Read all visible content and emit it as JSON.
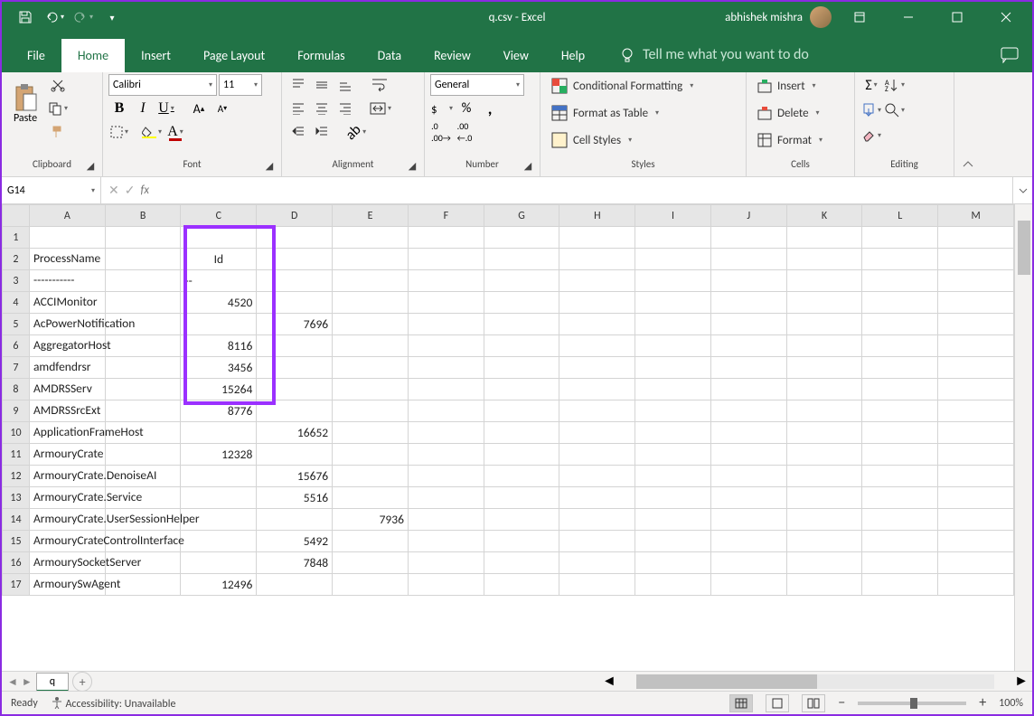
{
  "title": "q.csv - Excel",
  "user": "abhishek mishra",
  "tabs": [
    "File",
    "Home",
    "Insert",
    "Page Layout",
    "Formulas",
    "Data",
    "Review",
    "View",
    "Help"
  ],
  "tell": "Tell me what you want to do",
  "font": {
    "name": "Calibri",
    "size": "11"
  },
  "num_format": "General",
  "groups": {
    "clipboard": "Clipboard",
    "font": "Font",
    "alignment": "Alignment",
    "number": "Number",
    "styles": "Styles",
    "cells": "Cells",
    "editing": "Editing"
  },
  "paste": "Paste",
  "styles": {
    "cond": "Conditional Formatting",
    "table": "Format as Table",
    "cell": "Cell Styles"
  },
  "cells": {
    "insert": "Insert",
    "delete": "Delete",
    "format": "Format"
  },
  "namebox": "G14",
  "sheet_tab": "q",
  "status": {
    "ready": "Ready",
    "acc": "Accessibility: Unavailable",
    "zoom": "100%"
  },
  "cols": [
    "A",
    "B",
    "C",
    "D",
    "E",
    "F",
    "G",
    "H",
    "I",
    "J",
    "K",
    "L",
    "M"
  ],
  "rows": [
    {
      "n": 1,
      "a": "",
      "c": ""
    },
    {
      "n": 2,
      "a": "ProcessName",
      "c": "Id",
      "c_align": "center"
    },
    {
      "n": 3,
      "a": "-----------",
      "c": "--"
    },
    {
      "n": 4,
      "a": "ACCIMonitor",
      "c": "4520",
      "num": true
    },
    {
      "n": 5,
      "a": "AcPowerNotification",
      "c": "7696",
      "num": true,
      "overflow_col": "D"
    },
    {
      "n": 6,
      "a": "AggregatorHost",
      "c": "8116",
      "num": true
    },
    {
      "n": 7,
      "a": "amdfendrsr",
      "c": "3456",
      "num": true
    },
    {
      "n": 8,
      "a": "AMDRSServ",
      "c": "15264",
      "num": true
    },
    {
      "n": 9,
      "a": "AMDRSSrcExt",
      "c": "8776",
      "num": true
    },
    {
      "n": 10,
      "a": "ApplicationFrameHost",
      "c": "16652",
      "num": true,
      "overflow_col": "D"
    },
    {
      "n": 11,
      "a": "ArmouryCrate",
      "c": "12328",
      "num": true
    },
    {
      "n": 12,
      "a": "ArmouryCrate.DenoiseAI",
      "c": "15676",
      "num": true,
      "overflow_col": "D"
    },
    {
      "n": 13,
      "a": "ArmouryCrate.Service",
      "c": "5516",
      "num": true,
      "overflow_col": "D"
    },
    {
      "n": 14,
      "a": "ArmouryCrate.UserSessionHelper",
      "c": "7936",
      "num": true,
      "overflow_col": "E"
    },
    {
      "n": 15,
      "a": "ArmouryCrateControlInterface",
      "c": "5492",
      "num": true,
      "overflow_col": "D"
    },
    {
      "n": 16,
      "a": "ArmourySocketServer",
      "c": "7848",
      "num": true,
      "overflow_col": "D"
    },
    {
      "n": 17,
      "a": "ArmourySwAgent",
      "c": "12496",
      "num": true
    }
  ]
}
